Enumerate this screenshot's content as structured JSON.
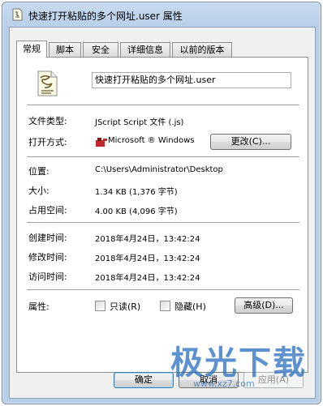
{
  "window": {
    "title": "快速打开粘贴的多个网址.user 属性",
    "icon": "script-file-icon"
  },
  "tabs": [
    {
      "label": "常规",
      "active": true
    },
    {
      "label": "脚本",
      "active": false
    },
    {
      "label": "安全",
      "active": false
    },
    {
      "label": "详细信息",
      "active": false
    },
    {
      "label": "以前的版本",
      "active": false
    }
  ],
  "general": {
    "file_name": "快速打开粘贴的多个网址.user",
    "file_type_label": "文件类型:",
    "file_type_value": "JScript Script 文件 (.js)",
    "open_with_label": "打开方式:",
    "open_with_value": "Microsoft ® Windows",
    "change_button": "更改(C)...",
    "location_label": "位置:",
    "location_value": "C:\\Users\\Administrator\\Desktop",
    "size_label": "大小:",
    "size_value": "1.34 KB (1,376 字节)",
    "disk_size_label": "占用空间:",
    "disk_size_value": "4.00 KB (4,096 字节)",
    "created_label": "创建时间:",
    "created_value": "2018年4月24日，13:42:24",
    "modified_label": "修改时间:",
    "modified_value": "2018年4月24日，13:42:24",
    "accessed_label": "访问时间:",
    "accessed_value": "2018年4月24日，13:42:24",
    "attributes_label": "属性:",
    "readonly_label": "只读(R)",
    "hidden_label": "隐藏(H)",
    "advanced_button": "高级(D)..."
  },
  "footer": {
    "ok": "确定",
    "cancel": "取消",
    "apply": "应用(A)"
  },
  "watermark": {
    "text": "极光下载",
    "url": "www.xz7.com"
  }
}
